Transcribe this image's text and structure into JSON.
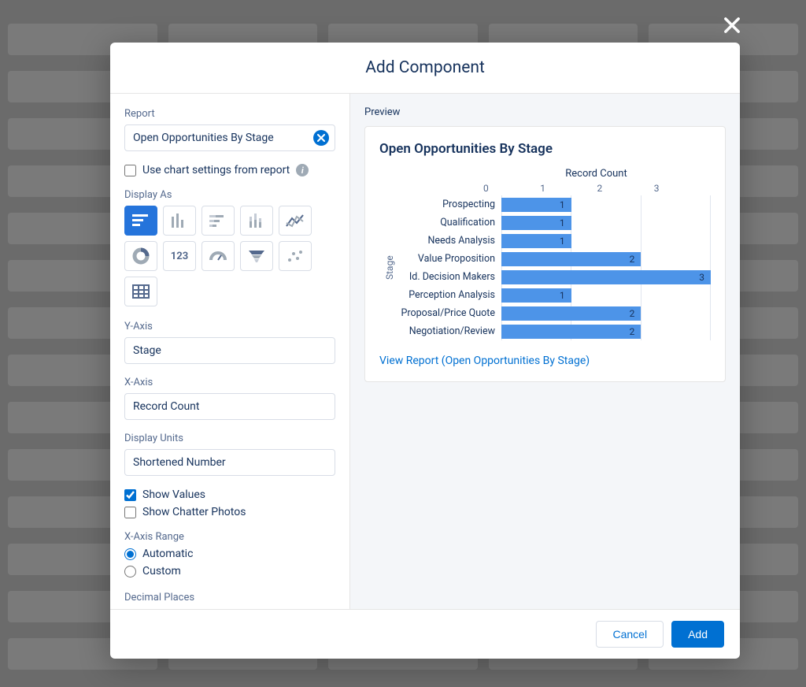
{
  "modal": {
    "title": "Add Component",
    "footer": {
      "cancel": "Cancel",
      "add": "Add"
    }
  },
  "left": {
    "report_label": "Report",
    "report_value": "Open Opportunities By Stage",
    "use_chart_settings": "Use chart settings from report",
    "display_as_label": "Display As",
    "yaxis_label": "Y-Axis",
    "yaxis_value": "Stage",
    "xaxis_label": "X-Axis",
    "xaxis_value": "Record Count",
    "display_units_label": "Display Units",
    "display_units_value": "Shortened Number",
    "show_values": "Show Values",
    "show_chatter": "Show Chatter Photos",
    "xaxis_range_label": "X-Axis Range",
    "range_auto": "Automatic",
    "range_custom": "Custom",
    "decimal_places_label": "Decimal Places",
    "metric_label": "123"
  },
  "preview": {
    "label": "Preview",
    "title": "Open Opportunities By Stage",
    "yaxis": "Stage",
    "view_link": "View Report (Open Opportunities By Stage)"
  },
  "chart_data": {
    "type": "bar",
    "orientation": "horizontal",
    "title": "Open Opportunities By Stage",
    "xlabel": "Record Count",
    "ylabel": "Stage",
    "xlim": [
      0,
      3
    ],
    "ticks": [
      0,
      1,
      2,
      3
    ],
    "categories": [
      "Prospecting",
      "Qualification",
      "Needs Analysis",
      "Value Proposition",
      "Id. Decision Makers",
      "Perception Analysis",
      "Proposal/Price Quote",
      "Negotiation/Review"
    ],
    "values": [
      1,
      1,
      1,
      2,
      3,
      1,
      2,
      2
    ]
  }
}
